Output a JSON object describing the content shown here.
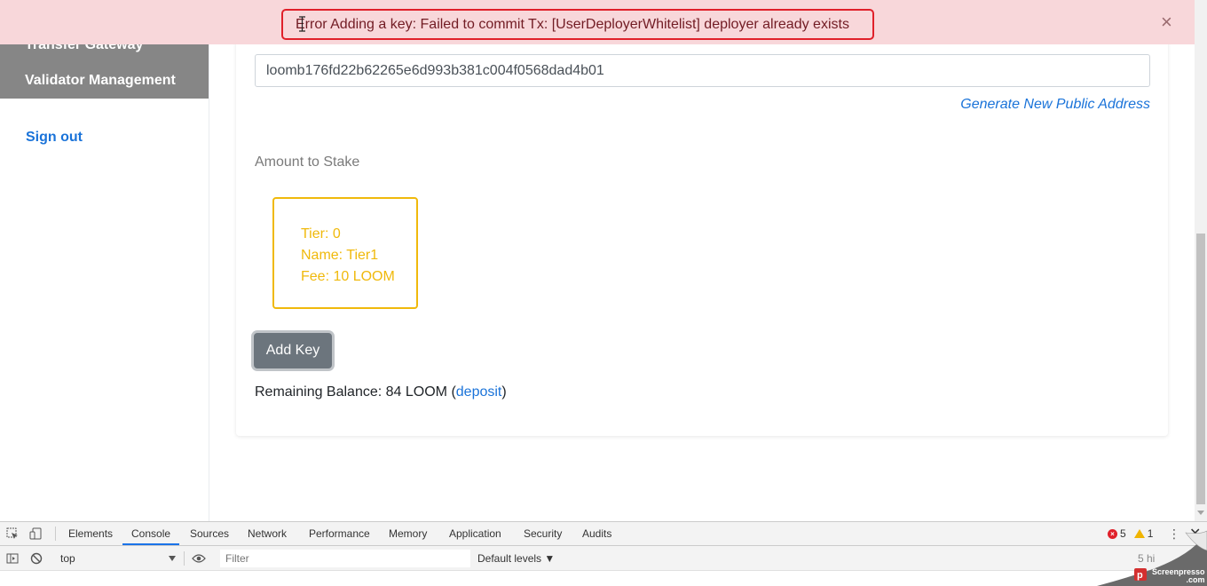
{
  "sidebar": {
    "items": [
      {
        "label": "Transfer Gateway"
      },
      {
        "label": "Validator Management"
      }
    ],
    "signout": "Sign out"
  },
  "main": {
    "address_value": "loomb176fd22b62265e6d993b381c004f0568dad4b01",
    "generate_link": "Generate New Public Address",
    "stake_label": "Amount to Stake",
    "tier": {
      "line1": "Tier: 0",
      "line2": "Name: Tier1",
      "line3": "Fee: 10 LOOM"
    },
    "add_key_button": "Add Key",
    "balance_prefix": "Remaining Balance: 84 LOOM (",
    "balance_link": "deposit",
    "balance_suffix": ")"
  },
  "alert": {
    "message": "Error Adding a key: Failed to commit Tx: [UserDeployerWhitelist] deployer already exists",
    "close": "×"
  },
  "devtools": {
    "tabs": [
      "Elements",
      "Console",
      "Sources",
      "Network",
      "Performance",
      "Memory",
      "Application",
      "Security",
      "Audits"
    ],
    "active_tab": "Console",
    "error_count": "5",
    "warning_count": "1",
    "context": "top",
    "filter_placeholder": "Filter",
    "levels": "Default levels ▼",
    "hidden_count": "5 hi"
  },
  "watermark": {
    "line1": "Screenpresso",
    "line2": ".com"
  },
  "colors": {
    "accent_link": "#1a73d9",
    "tier_border": "#f0b90b",
    "alert_bg": "#f8d7da",
    "alert_border": "#e0202a",
    "button_bg": "#6c757d",
    "sidebar_nav_bg": "#868686"
  }
}
